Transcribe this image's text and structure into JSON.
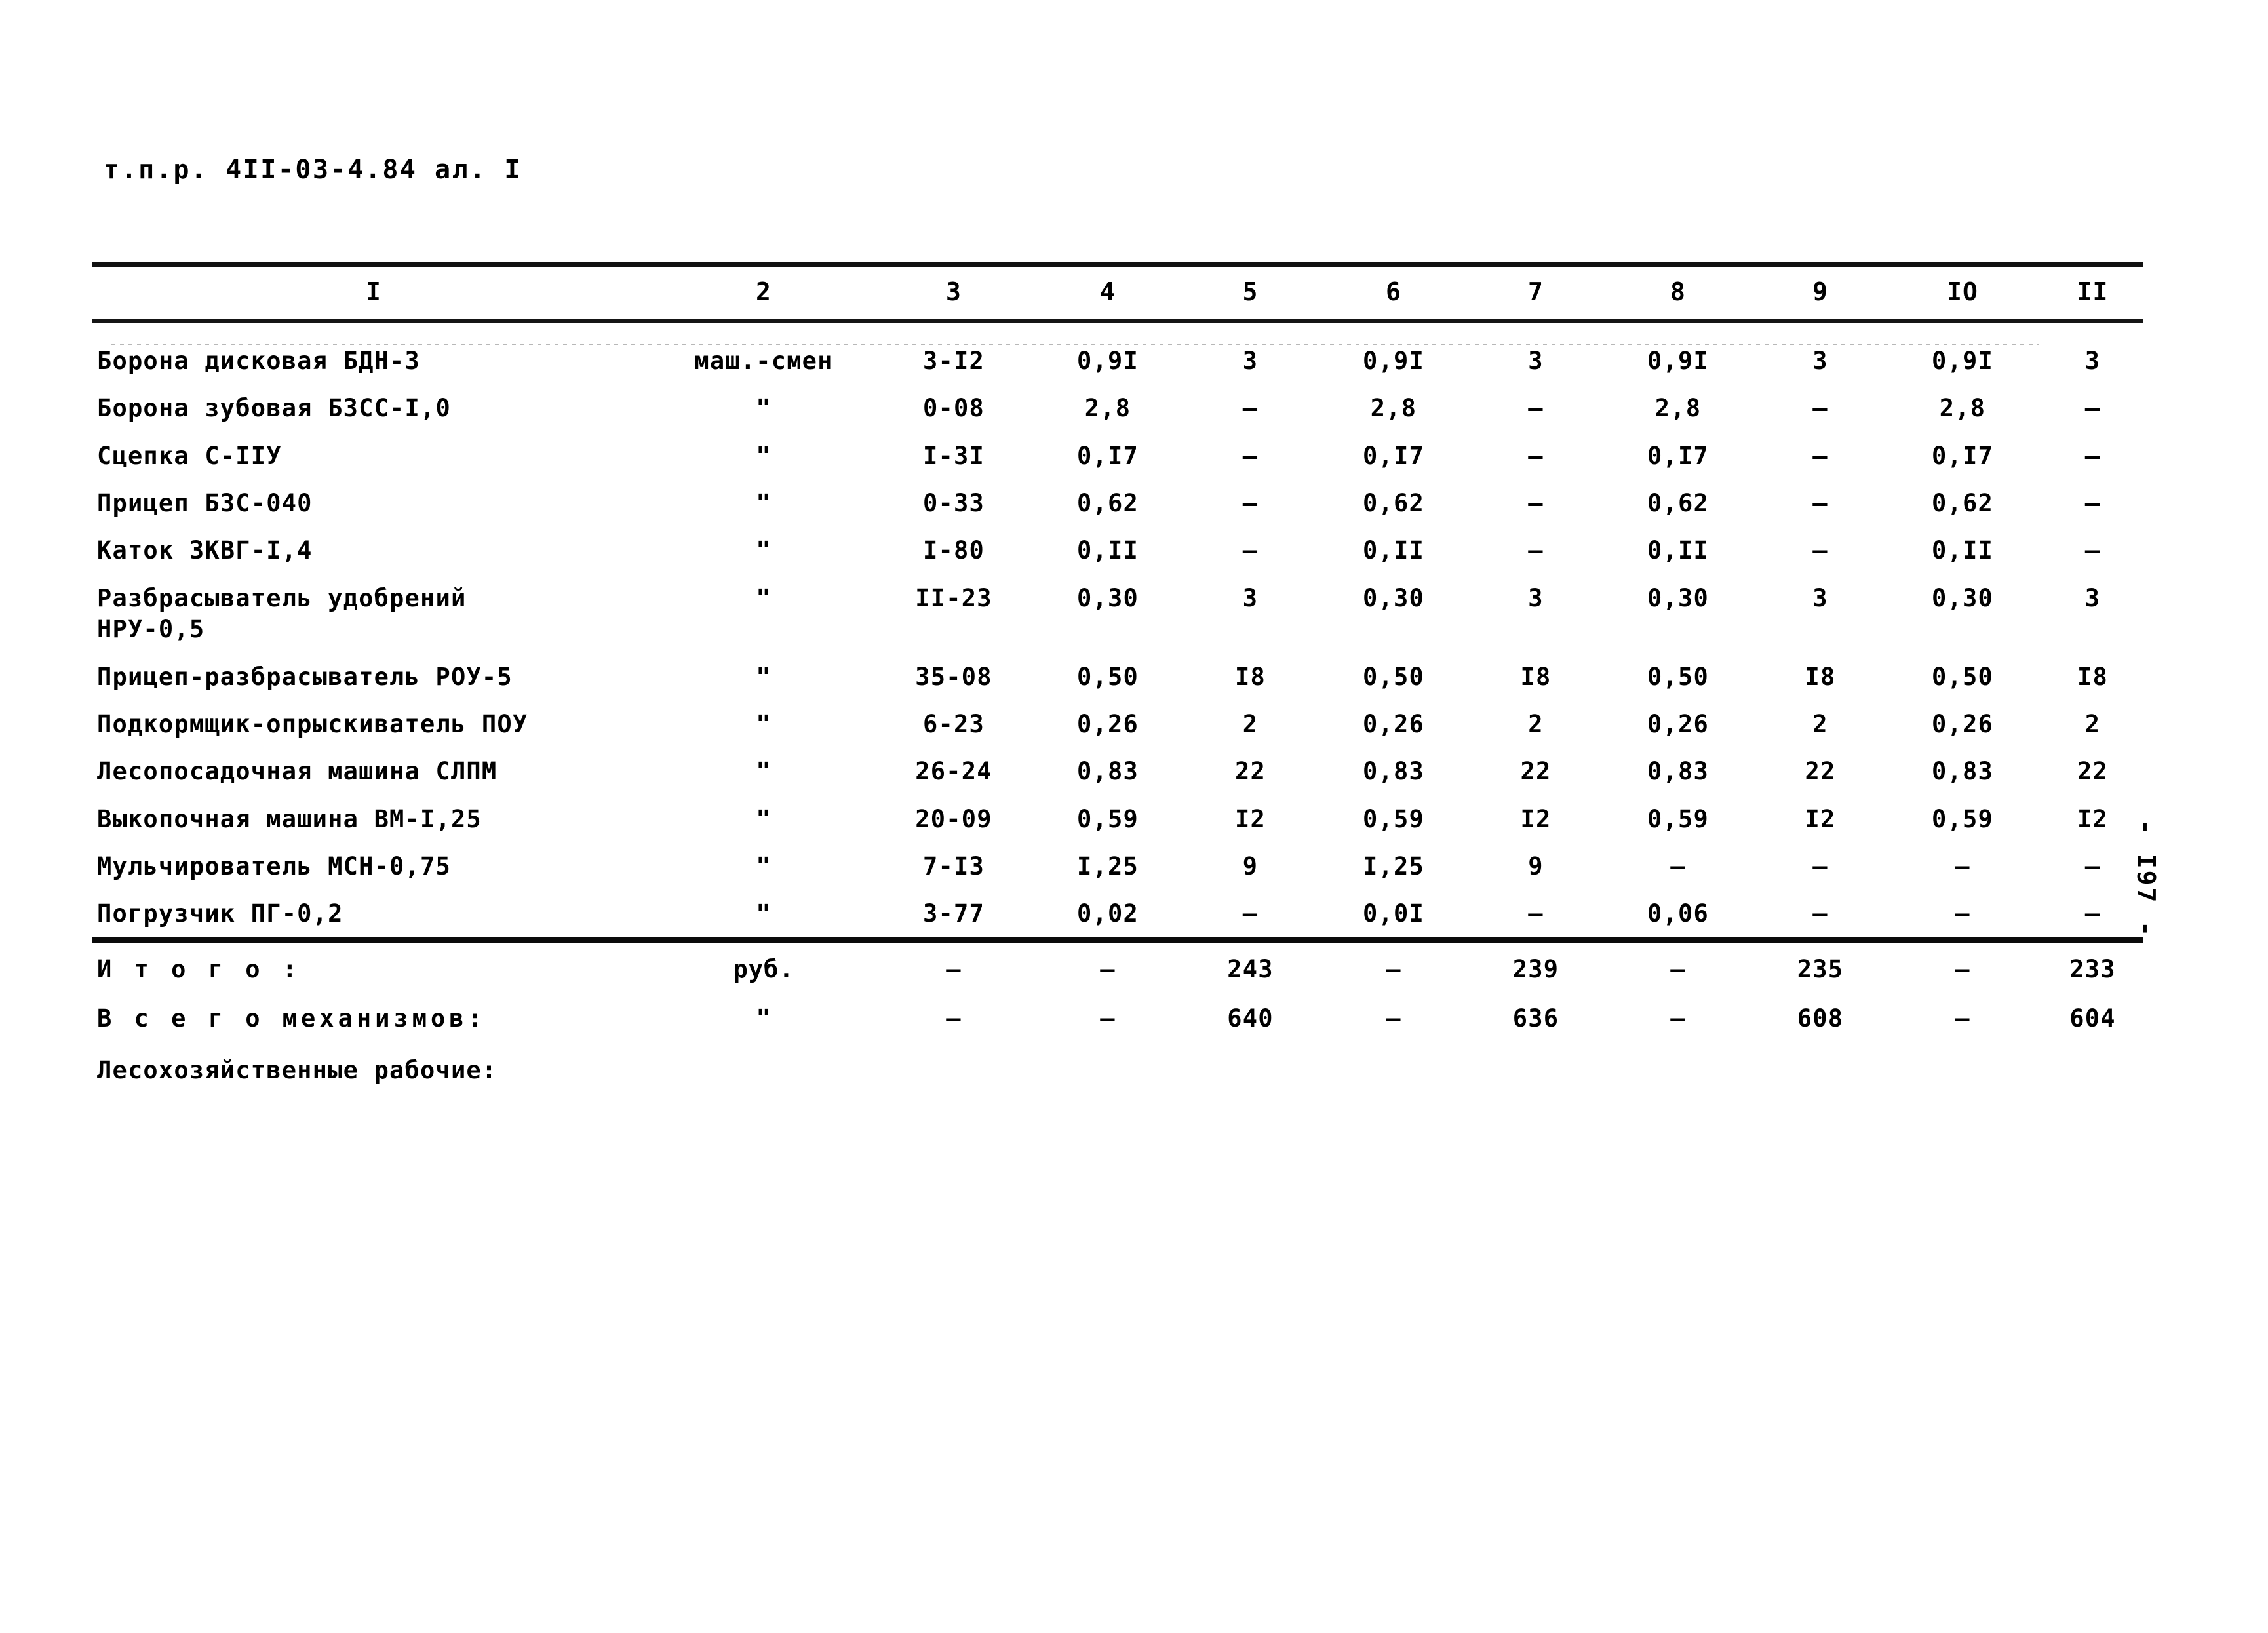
{
  "document": {
    "header_line": "т.п.р. 4II-03-4.84 ал. I",
    "page_number": "- I97 -"
  },
  "table": {
    "column_headers": [
      "I",
      "2",
      "3",
      "4",
      "5",
      "6",
      "7",
      "8",
      "9",
      "IO",
      "II"
    ],
    "rows": [
      {
        "name": "Борона дисковая БДН-3",
        "unit": "маш.-смен",
        "c3": "3-I2",
        "c4": "0,9I",
        "c5": "3",
        "c6": "0,9I",
        "c7": "3",
        "c8": "0,9I",
        "c9": "3",
        "c10": "0,9I",
        "c11": "3"
      },
      {
        "name": "Борона зубовая БЗСС-I,0",
        "unit": "\"",
        "c3": "0-08",
        "c4": "2,8",
        "c5": "–",
        "c6": "2,8",
        "c7": "–",
        "c8": "2,8",
        "c9": "–",
        "c10": "2,8",
        "c11": "–"
      },
      {
        "name": "Сцепка С-IIУ",
        "unit": "\"",
        "c3": "I-3I",
        "c4": "0,I7",
        "c5": "–",
        "c6": "0,I7",
        "c7": "–",
        "c8": "0,I7",
        "c9": "–",
        "c10": "0,I7",
        "c11": "–"
      },
      {
        "name": "Прицеп БЗС-040",
        "unit": "\"",
        "c3": "0-33",
        "c4": "0,62",
        "c5": "–",
        "c6": "0,62",
        "c7": "–",
        "c8": "0,62",
        "c9": "–",
        "c10": "0,62",
        "c11": "–"
      },
      {
        "name": "Каток ЗКВГ-I,4",
        "unit": "\"",
        "c3": "I-80",
        "c4": "0,II",
        "c5": "–",
        "c6": "0,II",
        "c7": "–",
        "c8": "0,II",
        "c9": "–",
        "c10": "0,II",
        "c11": "–"
      },
      {
        "name": "Разбрасыватель удобрений\nНРУ-0,5",
        "unit": "\"",
        "c3": "II-23",
        "c4": "0,30",
        "c5": "3",
        "c6": "0,30",
        "c7": "3",
        "c8": "0,30",
        "c9": "3",
        "c10": "0,30",
        "c11": "3"
      },
      {
        "name": "Прицеп-разбрасыватель РОУ-5",
        "unit": "\"",
        "c3": "35-08",
        "c4": "0,50",
        "c5": "I8",
        "c6": "0,50",
        "c7": "I8",
        "c8": "0,50",
        "c9": "I8",
        "c10": "0,50",
        "c11": "I8"
      },
      {
        "name": "Подкормщик-опрыскиватель ПОУ",
        "unit": "\"",
        "c3": "6-23",
        "c4": "0,26",
        "c5": "2",
        "c6": "0,26",
        "c7": "2",
        "c8": "0,26",
        "c9": "2",
        "c10": "0,26",
        "c11": "2"
      },
      {
        "name": "Лесопосадочная машина СЛПМ",
        "unit": "\"",
        "c3": "26-24",
        "c4": "0,83",
        "c5": "22",
        "c6": "0,83",
        "c7": "22",
        "c8": "0,83",
        "c9": "22",
        "c10": "0,83",
        "c11": "22"
      },
      {
        "name": "Выкопочная машина ВМ-I,25",
        "unit": "\"",
        "c3": "20-09",
        "c4": "0,59",
        "c5": "I2",
        "c6": "0,59",
        "c7": "I2",
        "c8": "0,59",
        "c9": "I2",
        "c10": "0,59",
        "c11": "I2"
      },
      {
        "name": "Мульчирователь МСН-0,75",
        "unit": "\"",
        "c3": "7-I3",
        "c4": "I,25",
        "c5": "9",
        "c6": "I,25",
        "c7": "9",
        "c8": "–",
        "c9": "–",
        "c10": "–",
        "c11": "–"
      },
      {
        "name": "Погрузчик ПГ-0,2",
        "unit": "\"",
        "c3": "3-77",
        "c4": "0,02",
        "c5": "–",
        "c6": "0,0I",
        "c7": "–",
        "c8": "0,06",
        "c9": "–",
        "c10": "–",
        "c11": "–"
      }
    ],
    "totals": [
      {
        "name": "И т о г о :",
        "unit": "руб.",
        "c3": "–",
        "c4": "–",
        "c5": "243",
        "c6": "–",
        "c7": "239",
        "c8": "–",
        "c9": "235",
        "c10": "–",
        "c11": "233"
      },
      {
        "name": "В с е г о  механизмов:",
        "unit": "\"",
        "c3": "–",
        "c4": "–",
        "c5": "640",
        "c6": "–",
        "c7": "636",
        "c8": "–",
        "c9": "608",
        "c10": "–",
        "c11": "604"
      }
    ],
    "trailing_label": "Лесохозяйственные рабочие:"
  }
}
